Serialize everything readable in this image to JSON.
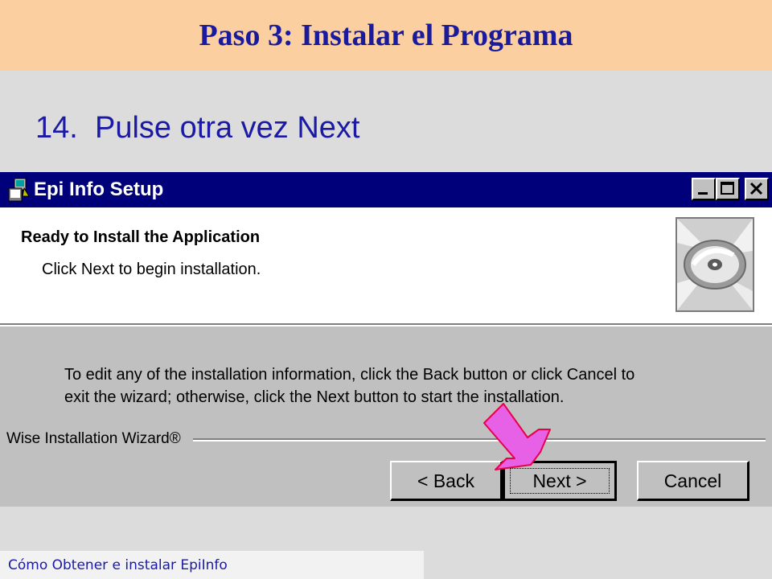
{
  "slide": {
    "title": "Paso 3: Instalar el Programa",
    "step_number": "14.",
    "step_text": "Pulse otra vez Next",
    "footer": "Cómo Obtener e instalar EpiInfo"
  },
  "dialog": {
    "window_title": "Epi Info Setup",
    "heading": "Ready to Install the Application",
    "subheading": "Click Next to begin installation.",
    "body_line1": "To edit any of the installation information, click the Back button or click Cancel to",
    "body_line2": "exit the wizard; otherwise, click  the Next button to start the installation.",
    "wizard_label": "Wise Installation Wizard®",
    "buttons": {
      "back_label": "< Back",
      "next_label": "Next >",
      "cancel_label": "Cancel"
    },
    "title_icons": [
      "setup-app-icon",
      "minimize-icon",
      "maximize-icon",
      "close-icon"
    ],
    "header_icon": "cd-disc-icon"
  },
  "colors": {
    "title_band": "#fbcf9f",
    "title_text": "#1a1a9c",
    "window_titlebar": "#00007b",
    "dialog_face": "#c0c0c0",
    "arrow_fill": "#e661e6",
    "arrow_stroke": "#e8004c"
  }
}
